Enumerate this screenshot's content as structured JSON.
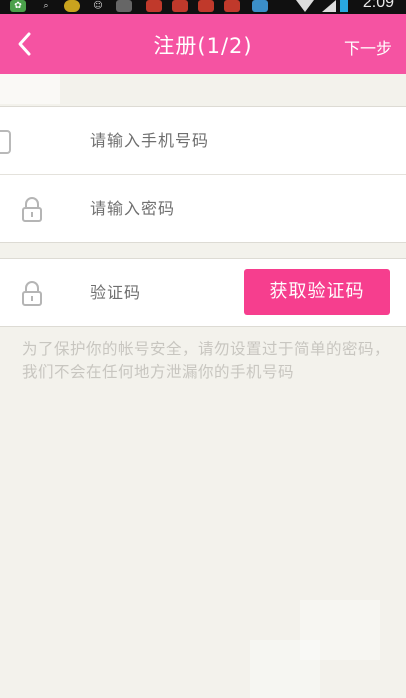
{
  "status_bar": {
    "time": "2:09"
  },
  "nav": {
    "title": "注册(1/2)",
    "next_label": "下一步",
    "accent_color": "#f553a2"
  },
  "form": {
    "phone_placeholder": "请输入手机号码",
    "password_placeholder": "请输入密码",
    "code_label": "验证码",
    "get_code_button": "获取验证码",
    "button_color": "#f63e8e"
  },
  "hint_text": "为了保护你的帐号安全，请勿设置过于简单的密码，我们不会在任何地方泄漏你的手机号码"
}
